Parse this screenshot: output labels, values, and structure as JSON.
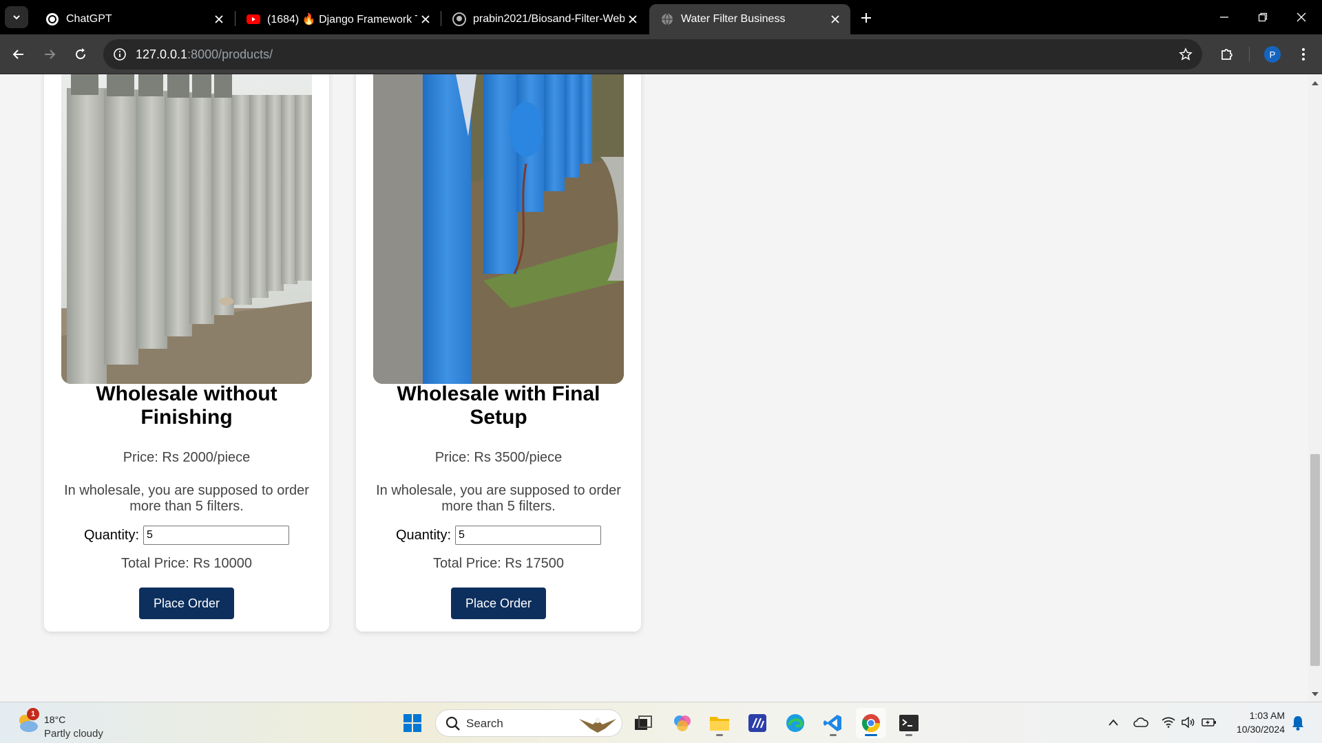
{
  "browser": {
    "tabs": [
      {
        "title": "ChatGPT",
        "icon": "chatgpt-icon"
      },
      {
        "title": "(1684) 🔥 Django Framework T",
        "icon": "youtube-icon"
      },
      {
        "title": "prabin2021/Biosand-Filter-Web",
        "icon": "github-icon"
      },
      {
        "title": "Water Filter Business",
        "icon": "globe-icon",
        "active": true
      }
    ],
    "url_host": "127.0.0.1",
    "url_path": ":8000/products/",
    "profile_initial": "P"
  },
  "products": [
    {
      "title": "Wholesale without Finishing",
      "price": "Price: Rs 2000/piece",
      "description": "In wholesale, you are supposed to order more than 5 filters.",
      "quantity_label": "Quantity:",
      "quantity": "5",
      "total": "Total Price: Rs 10000",
      "button": "Place Order",
      "image": "grey concrete filter columns"
    },
    {
      "title": "Wholesale with Final Setup",
      "price": "Price: Rs 3500/piece",
      "description": "In wholesale, you are supposed to order more than 5 filters.",
      "quantity_label": "Quantity:",
      "quantity": "5",
      "total": "Total Price: Rs 17500",
      "button": "Place Order",
      "image": "blue painted filter columns with buckets"
    }
  ],
  "taskbar": {
    "weather": {
      "temp": "18°C",
      "condition": "Partly cloudy",
      "badge": "1"
    },
    "search_label": "Search",
    "time": "1:03 AM",
    "date": "10/30/2024"
  },
  "colors": {
    "button": "#0d2f5e",
    "page_bg": "#f4f4f4",
    "tab_active": "#3c3c3c"
  }
}
